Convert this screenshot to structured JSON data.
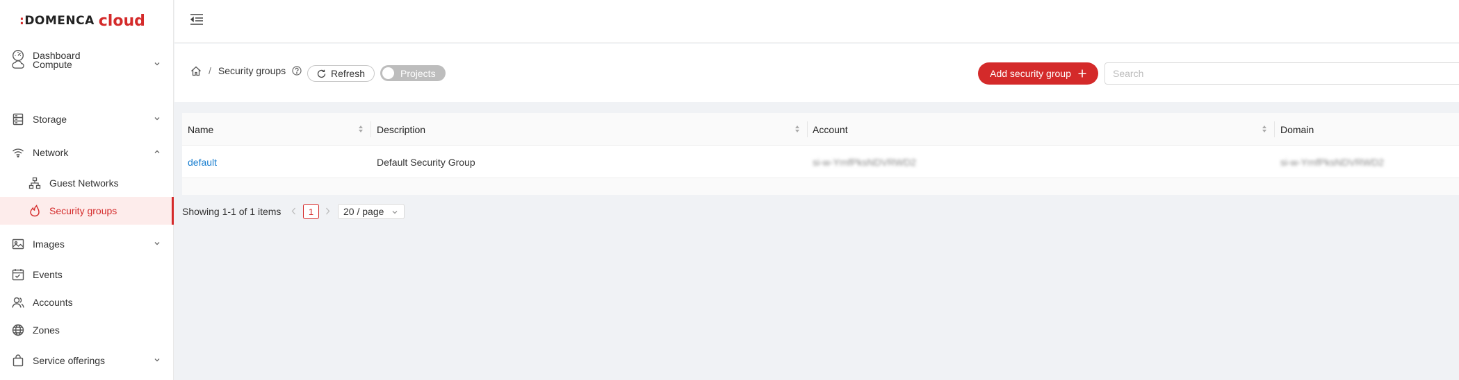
{
  "brand": {
    "prefix": ":",
    "name": "DOMENCA",
    "suffix": "cloud",
    "accent": "#d42a2a"
  },
  "sidebar": {
    "items": [
      {
        "label": "Dashboard",
        "icon": "dashboard-icon"
      },
      {
        "label": "Compute",
        "icon": "cloud-icon",
        "expandable": true
      },
      {
        "label": "Storage",
        "icon": "storage-icon",
        "expandable": true
      },
      {
        "label": "Network",
        "icon": "wifi-icon",
        "expandable": true,
        "expanded": true
      },
      {
        "label": "Guest Networks",
        "icon": "network-tree-icon",
        "sub": true
      },
      {
        "label": "Security groups",
        "icon": "fire-icon",
        "sub": true,
        "active": true
      },
      {
        "label": "Images",
        "icon": "image-icon",
        "expandable": true
      },
      {
        "label": "Events",
        "icon": "calendar-icon"
      },
      {
        "label": "Accounts",
        "icon": "users-icon"
      },
      {
        "label": "Zones",
        "icon": "globe-icon"
      },
      {
        "label": "Service offerings",
        "icon": "shopping-bag-icon",
        "expandable": true
      }
    ]
  },
  "breadcrumb": {
    "home_icon": "home-icon",
    "separator": "/",
    "current": "Security groups"
  },
  "toolbar": {
    "refresh_label": "Refresh",
    "projects_label": "Projects",
    "add_label": "Add security group",
    "search_placeholder": "Search"
  },
  "table": {
    "columns": [
      "Name",
      "Description",
      "Account",
      "Domain"
    ],
    "rows": [
      {
        "name": "default",
        "description": "Default Security Group",
        "account": "si-w-YrnfPksNDVRWD2",
        "domain": "si-w-YrnfPksNDVRWD2"
      }
    ]
  },
  "pagination": {
    "summary": "Showing 1-1 of 1 items",
    "current_page": "1",
    "page_size": "20 / page"
  }
}
